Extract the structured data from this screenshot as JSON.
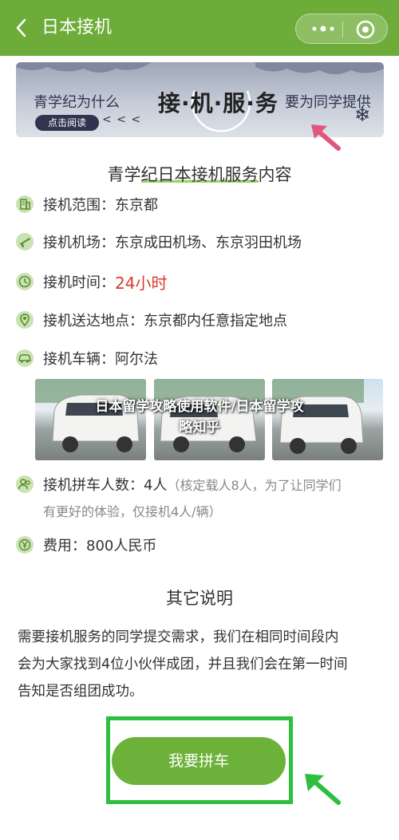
{
  "nav": {
    "title": "日本接机",
    "back_icon": "chevron-left-icon",
    "more_icon": "more-dots-icon",
    "close_icon": "target-icon",
    "color": "#6dac39"
  },
  "banner": {
    "left_text": "青学纪为什么",
    "main_text": "接·机·服·务",
    "right_text": "要为同学提供",
    "button": "点击阅读",
    "arrows": "< < <"
  },
  "section1": {
    "title_pre": "青学",
    "title_hl": "纪日本接机服务",
    "title_post": "内容"
  },
  "rows": [
    {
      "icon": "building-icon",
      "label": "接机范围：",
      "value": "东京都"
    },
    {
      "icon": "airplane-icon",
      "label": "接机机场：",
      "value": "东京成田机场、东京羽田机场"
    },
    {
      "icon": "clock-icon",
      "label": "接机时间：",
      "value": "24小时"
    },
    {
      "icon": "location-pin-icon",
      "label": "接机送达地点：",
      "value": "东京都内任意指定地点"
    },
    {
      "icon": "car-icon",
      "label": "接机车辆：",
      "value": "阿尔法"
    }
  ],
  "watermark": {
    "line1": "日本留学攻略使用软件/日本留学攻",
    "line2": "略知乎"
  },
  "carpool": {
    "icon": "people-icon",
    "label": "接机拼车人数：",
    "value": "4人",
    "note1": "（核定载人8人，为了让同学们",
    "note2": "有更好的体验，仅接机4人/辆）"
  },
  "fee": {
    "icon": "yen-icon",
    "label": "费用：",
    "value": "800人民币"
  },
  "section2": {
    "title": "其它说明"
  },
  "description": {
    "line1": "需要接机服务的同学提交需求，我们在相同时间段内",
    "line2": "会为大家找到4位小伙伴成团，并且我们会在第一时间",
    "line3": "告知是否组团成功。"
  },
  "cta": {
    "label": "我要拼车"
  },
  "colors": {
    "accent_green": "#6cb23a",
    "highlight_red": "#d83a2f",
    "frame_green": "#2ebf3f",
    "arrow_pink": "#e0567f"
  }
}
